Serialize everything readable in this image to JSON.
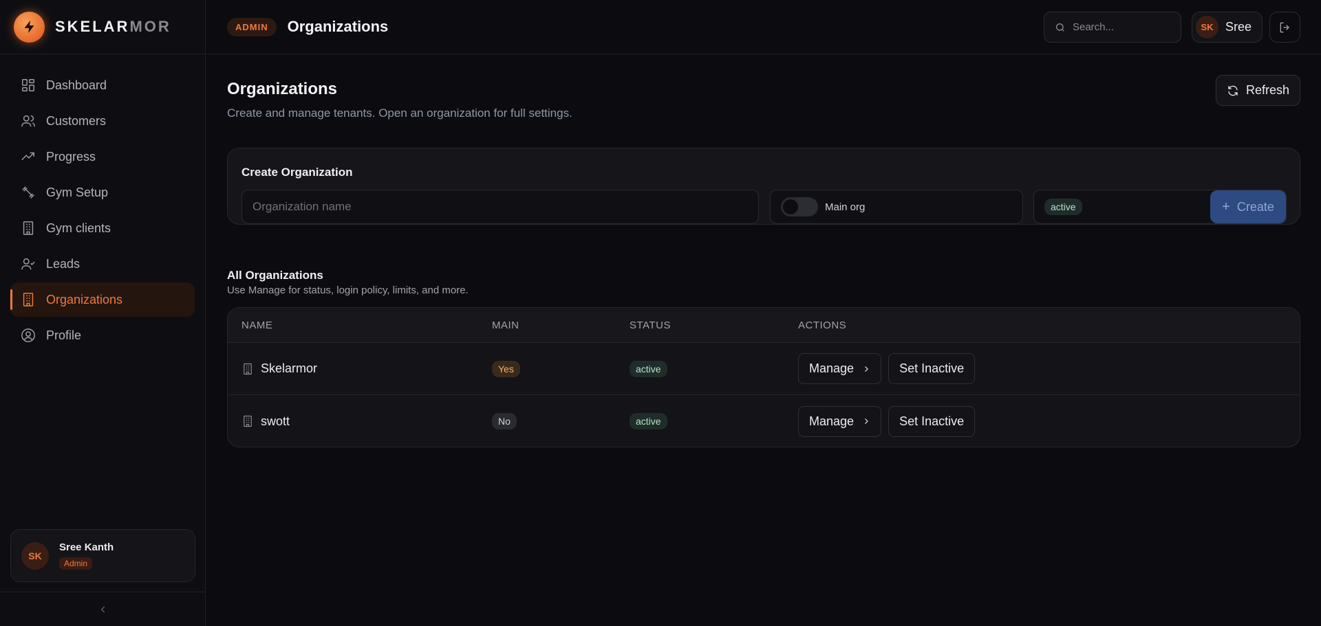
{
  "brand": {
    "name_part1": "SKELAR",
    "name_part2": "MOR"
  },
  "sidebar": {
    "items": [
      {
        "label": "Dashboard",
        "icon": "dashboard-icon"
      },
      {
        "label": "Customers",
        "icon": "users-icon"
      },
      {
        "label": "Progress",
        "icon": "trending-up-icon"
      },
      {
        "label": "Gym Setup",
        "icon": "dumbbell-icon"
      },
      {
        "label": "Gym clients",
        "icon": "building-icon"
      },
      {
        "label": "Leads",
        "icon": "user-check-icon"
      },
      {
        "label": "Organizations",
        "icon": "building-icon",
        "active": true
      },
      {
        "label": "Profile",
        "icon": "user-circle-icon"
      }
    ],
    "user": {
      "initials": "SK",
      "name": "Sree Kanth",
      "role": "Admin"
    }
  },
  "topbar": {
    "badge": "ADMIN",
    "title": "Organizations",
    "search_placeholder": "Search...",
    "user_initials": "SK",
    "user_name": "Sree"
  },
  "page": {
    "title": "Organizations",
    "subtitle": "Create and manage tenants. Open an organization for full settings.",
    "refresh_label": "Refresh"
  },
  "create": {
    "title": "Create Organization",
    "name_placeholder": "Organization name",
    "main_org_label": "Main org",
    "main_org_checked": false,
    "status_value": "active",
    "button_label": "Create"
  },
  "list": {
    "title": "All Organizations",
    "subtitle": "Use Manage for status, login policy, limits, and more.",
    "columns": [
      "NAME",
      "MAIN",
      "STATUS",
      "ACTIONS"
    ],
    "rows": [
      {
        "name": "Skelarmor",
        "main": "Yes",
        "status": "active",
        "manage": "Manage",
        "toggle": "Set Inactive"
      },
      {
        "name": "swott",
        "main": "No",
        "status": "active",
        "manage": "Manage",
        "toggle": "Set Inactive"
      }
    ]
  },
  "colors": {
    "accent": "#f07a3a",
    "background": "#0c0c10",
    "create_button": "#2e4a82"
  }
}
